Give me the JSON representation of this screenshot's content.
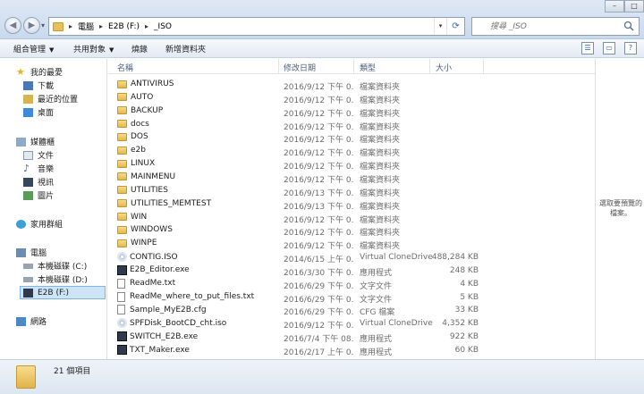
{
  "address": {
    "crumbs": [
      "電腦",
      "E2B (F:)",
      "_ISO"
    ]
  },
  "search": {
    "placeholder": "搜尋 _ISO"
  },
  "toolbar": {
    "organize": "組合管理",
    "share": "共用對象",
    "burn": "燒錄",
    "new_folder": "新增資料夾"
  },
  "sidebar": {
    "favorites": "我的最愛",
    "downloads": "下載",
    "recent": "最近的位置",
    "desktop": "桌面",
    "libraries": "媒體櫃",
    "documents": "文件",
    "music": "音樂",
    "videos": "視訊",
    "pictures": "圖片",
    "homegroup": "家用群組",
    "computer": "電腦",
    "drive_c": "本機磁碟 (C:)",
    "drive_d": "本機磁碟 (D:)",
    "drive_f": "E2B (F:)",
    "network": "網路"
  },
  "columns": {
    "name": "名稱",
    "date": "修改日期",
    "type": "類型",
    "size": "大小"
  },
  "files": [
    {
      "name": "ANTIVIRUS",
      "date": "2016/9/12 下午 0...",
      "type": "檔案資料夾",
      "size": "",
      "kind": "folder"
    },
    {
      "name": "AUTO",
      "date": "2016/9/12 下午 0...",
      "type": "檔案資料夾",
      "size": "",
      "kind": "folder"
    },
    {
      "name": "BACKUP",
      "date": "2016/9/12 下午 0...",
      "type": "檔案資料夾",
      "size": "",
      "kind": "folder"
    },
    {
      "name": "docs",
      "date": "2016/9/12 下午 0...",
      "type": "檔案資料夾",
      "size": "",
      "kind": "folder"
    },
    {
      "name": "DOS",
      "date": "2016/9/12 下午 0...",
      "type": "檔案資料夾",
      "size": "",
      "kind": "folder"
    },
    {
      "name": "e2b",
      "date": "2016/9/12 下午 0...",
      "type": "檔案資料夾",
      "size": "",
      "kind": "folder"
    },
    {
      "name": "LINUX",
      "date": "2016/9/12 下午 0...",
      "type": "檔案資料夾",
      "size": "",
      "kind": "folder"
    },
    {
      "name": "MAINMENU",
      "date": "2016/9/12 下午 0...",
      "type": "檔案資料夾",
      "size": "",
      "kind": "folder"
    },
    {
      "name": "UTILITIES",
      "date": "2016/9/13 下午 0...",
      "type": "檔案資料夾",
      "size": "",
      "kind": "folder"
    },
    {
      "name": "UTILITIES_MEMTEST",
      "date": "2016/9/13 下午 0...",
      "type": "檔案資料夾",
      "size": "",
      "kind": "folder"
    },
    {
      "name": "WIN",
      "date": "2016/9/12 下午 0...",
      "type": "檔案資料夾",
      "size": "",
      "kind": "folder"
    },
    {
      "name": "WINDOWS",
      "date": "2016/9/12 下午 0...",
      "type": "檔案資料夾",
      "size": "",
      "kind": "folder"
    },
    {
      "name": "WINPE",
      "date": "2016/9/12 下午 0...",
      "type": "檔案資料夾",
      "size": "",
      "kind": "folder"
    },
    {
      "name": "CONTIG.ISO",
      "date": "2014/6/15 上午 0...",
      "type": "Virtual CloneDrive",
      "size": "488,284 KB",
      "kind": "iso"
    },
    {
      "name": "E2B_Editor.exe",
      "date": "2016/3/30 下午 0...",
      "type": "應用程式",
      "size": "248 KB",
      "kind": "exe"
    },
    {
      "name": "ReadMe.txt",
      "date": "2016/6/29 下午 0...",
      "type": "文字文件",
      "size": "4 KB",
      "kind": "file"
    },
    {
      "name": "ReadMe_where_to_put_files.txt",
      "date": "2016/6/29 下午 0...",
      "type": "文字文件",
      "size": "5 KB",
      "kind": "file"
    },
    {
      "name": "Sample_MyE2B.cfg",
      "date": "2016/6/29 下午 0...",
      "type": "CFG 檔案",
      "size": "33 KB",
      "kind": "file"
    },
    {
      "name": "SPFDisk_BootCD_cht.iso",
      "date": "2016/9/12 下午 0...",
      "type": "Virtual CloneDrive",
      "size": "4,352 KB",
      "kind": "iso"
    },
    {
      "name": "SWITCH_E2B.exe",
      "date": "2016/7/4 下午 08...",
      "type": "應用程式",
      "size": "922 KB",
      "kind": "exe"
    },
    {
      "name": "TXT_Maker.exe",
      "date": "2016/2/17 上午 0...",
      "type": "應用程式",
      "size": "60 KB",
      "kind": "exe"
    }
  ],
  "preview": {
    "text": "選取要預覽的檔案。"
  },
  "details": {
    "count": "21 個項目"
  }
}
